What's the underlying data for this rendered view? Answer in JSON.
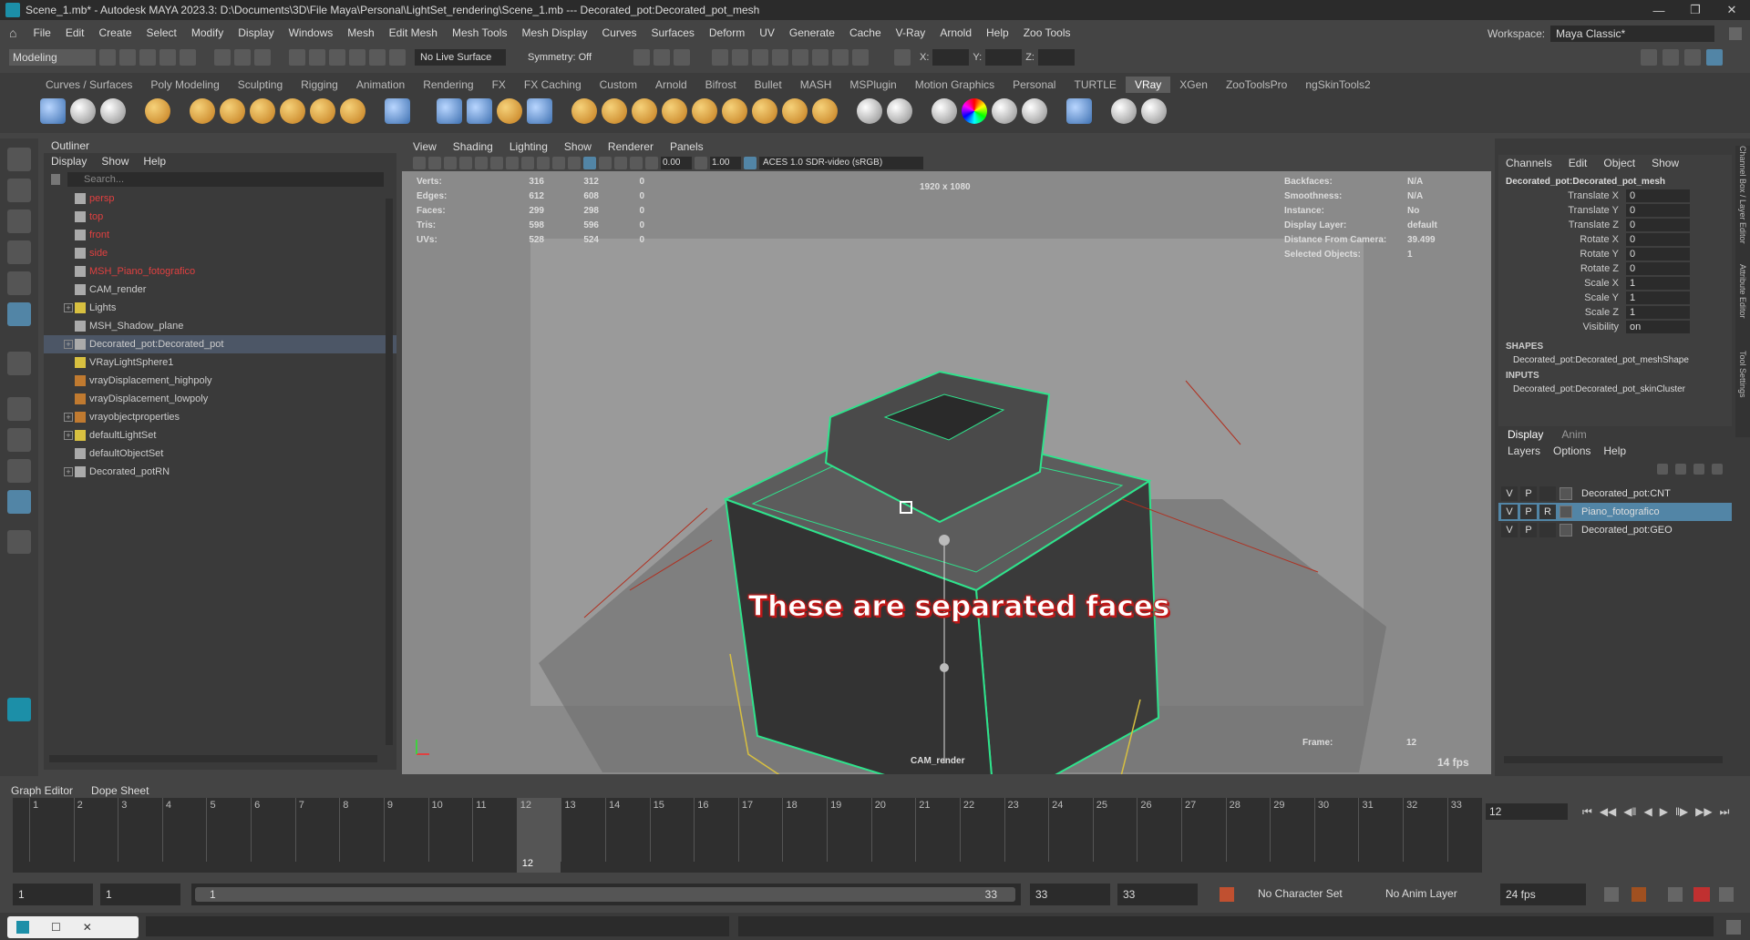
{
  "title": {
    "text": "Scene_1.mb* - Autodesk MAYA 2023.3: D:\\Documents\\3D\\File Maya\\Personal\\LightSet_rendering\\Scene_1.mb   ---   Decorated_pot:Decorated_pot_mesh"
  },
  "menubar": {
    "items": [
      "File",
      "Edit",
      "Create",
      "Select",
      "Modify",
      "Display",
      "Windows",
      "Mesh",
      "Edit Mesh",
      "Mesh Tools",
      "Mesh Display",
      "Curves",
      "Surfaces",
      "Deform",
      "UV",
      "Generate",
      "Cache",
      "V-Ray",
      "Arnold",
      "Help",
      "Zoo Tools"
    ],
    "workspace_label": "Workspace:",
    "workspace_value": "Maya Classic*"
  },
  "toolbar": {
    "mode": "Modeling",
    "live_surface": "No Live Surface",
    "symmetry": "Symmetry: Off",
    "x_label": "X:",
    "y_label": "Y:",
    "z_label": "Z:"
  },
  "shelf": {
    "tabs": [
      "Curves / Surfaces",
      "Poly Modeling",
      "Sculpting",
      "Rigging",
      "Animation",
      "Rendering",
      "FX",
      "FX Caching",
      "Custom",
      "Arnold",
      "Bifrost",
      "Bullet",
      "MASH",
      "MSPlugin",
      "Motion Graphics",
      "Personal",
      "TURTLE",
      "VRay",
      "XGen",
      "ZooToolsPro",
      "ngSkinTools2"
    ],
    "active": "VRay"
  },
  "outliner": {
    "title": "Outliner",
    "menu": [
      "Display",
      "Show",
      "Help"
    ],
    "search_placeholder": "Search...",
    "items": [
      {
        "label": "persp",
        "red": true,
        "expand": false
      },
      {
        "label": "top",
        "red": true,
        "expand": false
      },
      {
        "label": "front",
        "red": true,
        "expand": false
      },
      {
        "label": "side",
        "red": true,
        "expand": false
      },
      {
        "label": "MSH_Piano_fotografico",
        "red": true,
        "expand": false
      },
      {
        "label": "CAM_render",
        "red": false,
        "expand": false
      },
      {
        "label": "Lights",
        "red": false,
        "expand": true
      },
      {
        "label": "MSH_Shadow_plane",
        "red": false,
        "expand": false
      },
      {
        "label": "Decorated_pot:Decorated_pot",
        "red": false,
        "expand": true,
        "selected": true
      },
      {
        "label": "VRayLightSphere1",
        "red": false,
        "expand": false
      },
      {
        "label": "vrayDisplacement_highpoly",
        "red": false,
        "expand": false
      },
      {
        "label": "vrayDisplacement_lowpoly",
        "red": false,
        "expand": false
      },
      {
        "label": "vrayobjectproperties",
        "red": false,
        "expand": true
      },
      {
        "label": "defaultLightSet",
        "red": false,
        "expand": true
      },
      {
        "label": "defaultObjectSet",
        "red": false,
        "expand": false
      },
      {
        "label": "Decorated_potRN",
        "red": false,
        "expand": true
      }
    ]
  },
  "viewport": {
    "menu": [
      "View",
      "Shading",
      "Lighting",
      "Show",
      "Renderer",
      "Panels"
    ],
    "near": "0.00",
    "far": "1.00",
    "colorspace": "ACES 1.0 SDR-video (sRGB)",
    "resolution": "1920 x 1080",
    "stats": [
      {
        "label": "Verts:",
        "a": "316",
        "b": "312",
        "c": "0"
      },
      {
        "label": "Edges:",
        "a": "612",
        "b": "608",
        "c": "0"
      },
      {
        "label": "Faces:",
        "a": "299",
        "b": "298",
        "c": "0"
      },
      {
        "label": "Tris:",
        "a": "598",
        "b": "596",
        "c": "0"
      },
      {
        "label": "UVs:",
        "a": "528",
        "b": "524",
        "c": "0"
      }
    ],
    "info": [
      {
        "label": "Backfaces:",
        "value": "N/A"
      },
      {
        "label": "Smoothness:",
        "value": "N/A"
      },
      {
        "label": "Instance:",
        "value": "No"
      },
      {
        "label": "Display Layer:",
        "value": "default"
      },
      {
        "label": "Distance From Camera:",
        "value": "39.499"
      },
      {
        "label": "Selected Objects:",
        "value": "1"
      }
    ],
    "annotation": "These are separated faces",
    "camera": "CAM_render",
    "frame_label": "Frame:",
    "frame_value": "12",
    "fps": "14 fps"
  },
  "channel_box": {
    "menu": [
      "Channels",
      "Edit",
      "Object",
      "Show"
    ],
    "object": "Decorated_pot:Decorated_pot_mesh",
    "channels": [
      {
        "label": "Translate X",
        "value": "0"
      },
      {
        "label": "Translate Y",
        "value": "0"
      },
      {
        "label": "Translate Z",
        "value": "0"
      },
      {
        "label": "Rotate X",
        "value": "0"
      },
      {
        "label": "Rotate Y",
        "value": "0"
      },
      {
        "label": "Rotate Z",
        "value": "0"
      },
      {
        "label": "Scale X",
        "value": "1"
      },
      {
        "label": "Scale Y",
        "value": "1"
      },
      {
        "label": "Scale Z",
        "value": "1"
      },
      {
        "label": "Visibility",
        "value": "on"
      }
    ],
    "shapes_label": "SHAPES",
    "shape": "Decorated_pot:Decorated_pot_meshShape",
    "inputs_label": "INPUTS",
    "input": "Decorated_pot:Decorated_pot_skinCluster",
    "side_tabs": [
      "Channel Box / Layer Editor",
      "Attribute Editor",
      "Tool Settings"
    ]
  },
  "layer_editor": {
    "tabs": [
      "Display",
      "Anim"
    ],
    "menu": [
      "Layers",
      "Options",
      "Help"
    ],
    "layers": [
      {
        "v": "V",
        "p": "P",
        "r": "",
        "name": "Decorated_pot:CNT",
        "selected": false
      },
      {
        "v": "V",
        "p": "P",
        "r": "R",
        "name": "Piano_fotografico",
        "selected": true
      },
      {
        "v": "V",
        "p": "P",
        "r": "",
        "name": "Decorated_pot:GEO",
        "selected": false
      }
    ]
  },
  "timeline": {
    "tabs": [
      "Graph Editor",
      "Dope Sheet"
    ],
    "ticks": [
      "1",
      "2",
      "3",
      "4",
      "5",
      "6",
      "7",
      "8",
      "9",
      "10",
      "11",
      "12",
      "13",
      "14",
      "15",
      "16",
      "17",
      "18",
      "19",
      "20",
      "21",
      "22",
      "23",
      "24",
      "25",
      "26",
      "27",
      "28",
      "29",
      "30",
      "31",
      "32",
      "33"
    ],
    "current": "12",
    "current_field": "12"
  },
  "range": {
    "start": "1",
    "anim_start": "1",
    "slider_start": "1",
    "slider_end": "33",
    "anim_end": "33",
    "end": "33",
    "character_set": "No Character Set",
    "anim_layer": "No Anim Layer",
    "fps": "24 fps"
  }
}
